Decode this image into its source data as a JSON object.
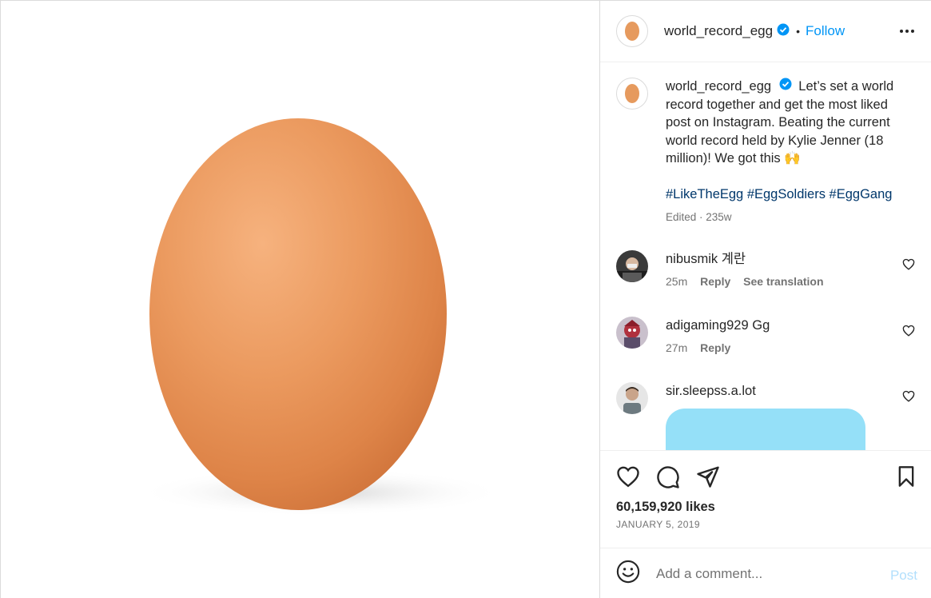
{
  "post": {
    "username": "world_record_egg",
    "follow_label": "Follow",
    "dot": "•",
    "caption_text": "Let’s set a world record together and get the most liked post on Instagram. Beating the current world record held by Kylie Jenner (18 million)! We got this 🙌",
    "hashtags": "#LikeTheEgg #EggSoldiers #EggGang",
    "caption_meta": "Edited · 235w",
    "likes": "60,159,920 likes",
    "date": "JANUARY 5, 2019"
  },
  "comments": [
    {
      "username": "nibusmik",
      "text": "계란",
      "time": "25m",
      "reply": "Reply",
      "translate": "See translation"
    },
    {
      "username": "adigaming929",
      "text": "Gg",
      "time": "27m",
      "reply": "Reply"
    },
    {
      "username": "sir.sleepss.a.lot",
      "text": ""
    }
  ],
  "comment_box": {
    "placeholder": "Add a comment...",
    "post_label": "Post"
  },
  "icons": {
    "more": "more-options-icon",
    "like": "heart-icon",
    "comment": "comment-icon",
    "share": "share-icon",
    "save": "bookmark-icon",
    "emoji": "emoji-icon",
    "verified": "verified-badge-icon"
  },
  "colors": {
    "link": "#0095f6",
    "hashtag": "#00376b",
    "muted": "#737373",
    "verified": "#0095f6"
  }
}
